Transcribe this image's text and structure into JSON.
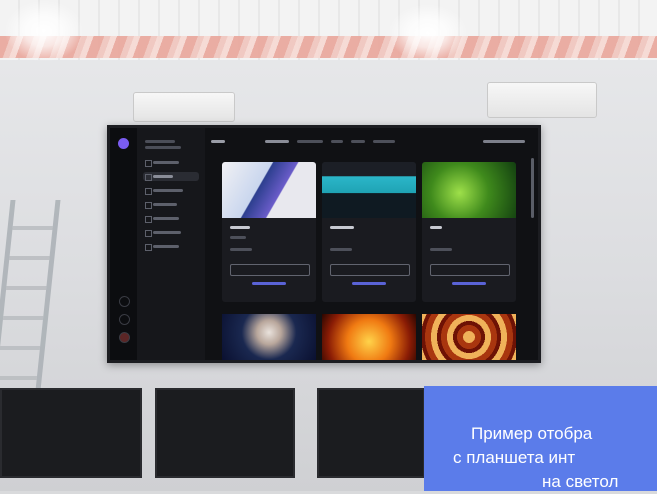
{
  "caption": {
    "line1": "Пример отобра",
    "line2": "с планшета  инт",
    "line3": "на светол"
  },
  "colors": {
    "caption_background": "#5b7cea",
    "screen_background": "#101114",
    "accent": "#7a5cf0"
  }
}
